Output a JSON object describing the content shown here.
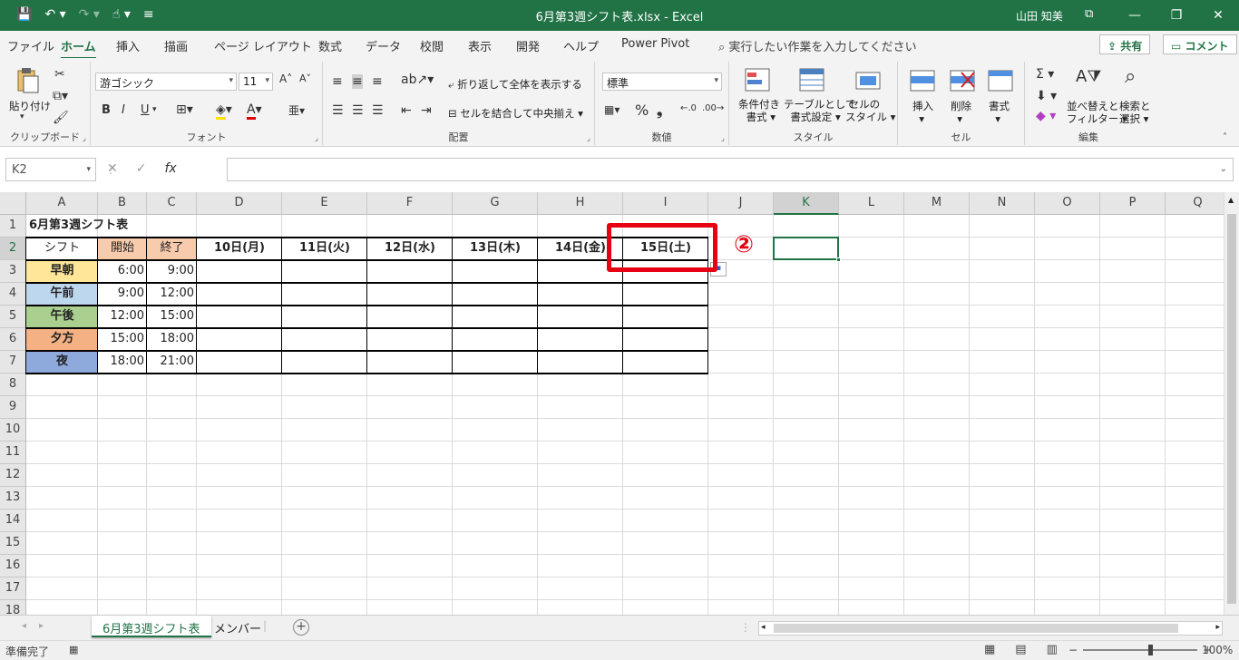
{
  "window": {
    "title": "6月第3週シフト表.xlsx  -  Excel",
    "user": "山田 知美"
  },
  "ribbon_tabs": [
    "ファイル",
    "ホーム",
    "挿入",
    "描画",
    "ページ レイアウト",
    "数式",
    "データ",
    "校閲",
    "表示",
    "開発",
    "ヘルプ",
    "Power Pivot"
  ],
  "active_tab": "ホーム",
  "tell_me": "実行したい作業を入力してください",
  "share_label": "共有",
  "comment_label": "コメント",
  "ribbon": {
    "clipboard": {
      "paste": "貼り付け",
      "label": "クリップボード"
    },
    "font": {
      "name": "游ゴシック",
      "size": "11",
      "label": "フォント",
      "bold": "B",
      "italic": "I",
      "underline": "U"
    },
    "alignment": {
      "wrap": "折り返して全体を表示する",
      "merge": "セルを結合して中央揃え",
      "label": "配置"
    },
    "number": {
      "format": "標準",
      "label": "数値"
    },
    "styles": {
      "conditional": [
        "条件付き",
        "書式"
      ],
      "table": [
        "テーブルとして",
        "書式設定"
      ],
      "cell": [
        "セルの",
        "スタイル"
      ],
      "label": "スタイル"
    },
    "cells": {
      "insert": "挿入",
      "delete": "削除",
      "format": "書式",
      "label": "セル"
    },
    "editing": {
      "sort": [
        "並べ替えと",
        "フィルター"
      ],
      "find": [
        "検索と",
        "選択"
      ],
      "label": "編集"
    }
  },
  "formula_bar": {
    "name_box": "K2",
    "fx": "fx",
    "content": ""
  },
  "columns": [
    "A",
    "B",
    "C",
    "D",
    "E",
    "F",
    "G",
    "H",
    "I",
    "J",
    "K",
    "L",
    "M",
    "N",
    "O",
    "P",
    "Q"
  ],
  "rows": [
    "1",
    "2",
    "3",
    "4",
    "5",
    "6",
    "7",
    "8",
    "9",
    "10",
    "11",
    "12",
    "13",
    "14",
    "15",
    "16",
    "17",
    "18"
  ],
  "selected_cell": "K2",
  "sheet": {
    "title": "6月第3週シフト表",
    "header": {
      "shift": "シフト",
      "start": "開始",
      "end": "終了"
    },
    "days": [
      "10日(月)",
      "11日(火)",
      "12日(水)",
      "13日(木)",
      "14日(金)",
      "15日(土)"
    ],
    "shifts": [
      {
        "name": "早朝",
        "start": "6:00",
        "end": "9:00",
        "color": "#ffe699"
      },
      {
        "name": "午前",
        "start": "9:00",
        "end": "12:00",
        "color": "#bdd7ee"
      },
      {
        "name": "午後",
        "start": "12:00",
        "end": "15:00",
        "color": "#a9d08e"
      },
      {
        "name": "夕方",
        "start": "15:00",
        "end": "18:00",
        "color": "#f4b183"
      },
      {
        "name": "夜",
        "start": "18:00",
        "end": "21:00",
        "color": "#8ea9db"
      }
    ]
  },
  "annotation": {
    "marker": "②",
    "color": "#e60012"
  },
  "sheet_tabs": [
    "6月第3週シフト表",
    "メンバー"
  ],
  "active_sheet": "6月第3週シフト表",
  "status": {
    "ready": "準備完了",
    "zoom": "100%"
  },
  "colors": {
    "excel_green": "#217346",
    "start_header": "#f8cbad",
    "end_header": "#f8cbad"
  }
}
